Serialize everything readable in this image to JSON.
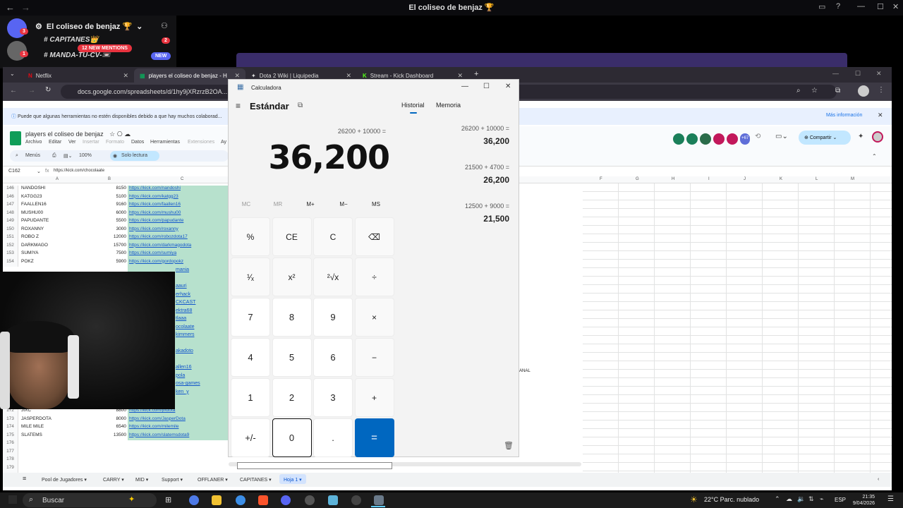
{
  "discord": {
    "window_title": "El coliseo de benjaz 🏆",
    "server_name": "El coliseo de benjaz 🏆",
    "badge_count": "3",
    "user_badge": "1",
    "channels": [
      {
        "name": "CAPITANES👑",
        "count": "2"
      },
      {
        "name": "MANDA-TU-CV-📼"
      }
    ],
    "new_mentions": "12 NEW MENTIONS",
    "new_label": "NEW"
  },
  "browser": {
    "tabs": [
      {
        "label": "Netflix",
        "color": "#e50914"
      },
      {
        "label": "players el coliseo de benjaz - H",
        "color": "#0f9d58"
      },
      {
        "label": "Dota 2 Wiki | Liquipedia",
        "color": "#bbbbbb"
      },
      {
        "label": "Stream - Kick Dashboard",
        "color": "#53fc18"
      }
    ],
    "url": "docs.google.com/spreadsheets/d/1hy9jXRzrzB2OA...",
    "info_text": "Puede que algunas herramientas no estén disponibles debido a que hay muchos colaborad...",
    "info_link": "Más información"
  },
  "sheets": {
    "doc_title": "players el coliseo de benjaz",
    "menus": [
      "Archivo",
      "Editar",
      "Ver",
      "Insertar",
      "Formato",
      "Datos",
      "Herramientas",
      "Extensiones",
      "Ay"
    ],
    "toolbar": {
      "menus": "Menús",
      "zoom": "100%",
      "readonly": "Solo lectura"
    },
    "share": "Compartir",
    "users_more": "+67",
    "cell_ref": "C162",
    "formula": "https://kick.com/chocolaate",
    "columns": [
      "A",
      "B",
      "C",
      "F",
      "G",
      "H",
      "I",
      "J",
      "K",
      "L",
      "M"
    ],
    "rows": [
      {
        "n": "146",
        "name": "NANDOSHI",
        "val": "8150",
        "link": "https://kick.com/nandoshi"
      },
      {
        "n": "146",
        "name": "KATGG23",
        "val": "5100",
        "link": "https://kick.com/katgg23"
      },
      {
        "n": "147",
        "name": "FAALLEN16",
        "val": "9160",
        "link": "https://kick.com/faallen16"
      },
      {
        "n": "148",
        "name": "MUSHU00",
        "val": "6000",
        "link": "https://kick.com/mushu00"
      },
      {
        "n": "149",
        "name": "PAPUDANTE",
        "val": "5500",
        "link": "https://kick.com/papudante"
      },
      {
        "n": "150",
        "name": "ROXANNY",
        "val": "3000",
        "link": "https://kick.com/roxanny"
      },
      {
        "n": "151",
        "name": "ROBO Z",
        "val": "12000",
        "link": "https://kick.com/robozdota17"
      },
      {
        "n": "152",
        "name": "DARKMAGO",
        "val": "15700",
        "link": "https://kick.com/darkmagodota"
      },
      {
        "n": "153",
        "name": "SUMIYA",
        "val": "7500",
        "link": "https://kick.com/sumiya"
      },
      {
        "n": "154",
        "name": "POKZ",
        "val": "5900",
        "link": "https://kick.com/gordopokz"
      }
    ],
    "partial_links": [
      "mania",
      "",
      "aauri",
      "erhack",
      "CKCAST",
      "ektra68",
      "tlaaa",
      "ocolaate",
      "kimmers",
      "",
      "akadoto",
      "",
      "allen16",
      "pola",
      "osa-games",
      "ken_y"
    ],
    "lower_rows": [
      {
        "n": "172",
        "name": "JIXC",
        "val": "8800",
        "link": "https://kick.com/jixdota"
      },
      {
        "n": "173",
        "name": "JASPERDOTA",
        "val": "8000",
        "link": "https://kick.com/JasperDota"
      },
      {
        "n": "174",
        "name": "MILE MILE",
        "val": "6540",
        "link": "https://kick.com/milemile"
      },
      {
        "n": "175",
        "name": "SLATEMS",
        "val": "13500",
        "link": "https://kick.com/slatemsdota9"
      },
      {
        "n": "176",
        "name": "",
        "val": "",
        "link": ""
      },
      {
        "n": "177",
        "name": "",
        "val": "",
        "link": ""
      },
      {
        "n": "178",
        "name": "",
        "val": "",
        "link": ""
      },
      {
        "n": "179",
        "name": "",
        "val": "",
        "link": ""
      }
    ],
    "stray_text": "ANAL",
    "sheet_tabs": [
      "Pool de Jugadores",
      "CARRY",
      "MID",
      "Support",
      "OFFLANER",
      "CAPITANES",
      "Hoja 1"
    ]
  },
  "calculator": {
    "title": "Calculadora",
    "mode": "Estándar",
    "tabs": [
      "Historial",
      "Memoria"
    ],
    "expression": "26200 + 10000 =",
    "display": "36,200",
    "memory": [
      "MC",
      "MR",
      "M+",
      "M−",
      "MS"
    ],
    "keys": [
      [
        "%",
        "CE",
        "C",
        "⌫"
      ],
      [
        "¹⁄ₓ",
        "x²",
        "²√x",
        "÷"
      ],
      [
        "7",
        "8",
        "9",
        "×"
      ],
      [
        "4",
        "5",
        "6",
        "−"
      ],
      [
        "1",
        "2",
        "3",
        "+"
      ],
      [
        "+/-",
        "0",
        ".",
        "="
      ]
    ],
    "history": [
      {
        "expr": "26200   +   10000 =",
        "result": "36,200"
      },
      {
        "expr": "21500   +   4700 =",
        "result": "26,200"
      },
      {
        "expr": "12500   +   9000 =",
        "result": "21,500"
      }
    ]
  },
  "taskbar": {
    "search": "Buscar",
    "weather": "22°C  Parc. nublado",
    "lang": "ESP",
    "time": "21:35",
    "date": "9/04/2026"
  }
}
